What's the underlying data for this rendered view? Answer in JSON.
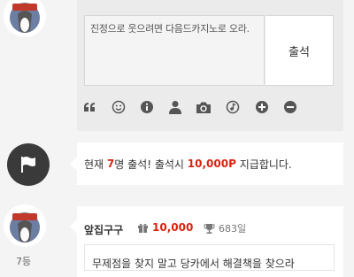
{
  "compose": {
    "text": "진정으로 웃으려면 다음드카지노로 오라.",
    "submit_label": "출석",
    "tools": [
      "quote-icon",
      "emoji-icon",
      "info-icon",
      "user-icon",
      "camera-icon",
      "music-icon",
      "plus-icon",
      "minus-icon"
    ]
  },
  "notice": {
    "prefix": "현재",
    "count": "7",
    "middle": "명 출석! 출석시",
    "points": "10,000P",
    "suffix": "지급합니다."
  },
  "entry": {
    "nickname": "앞집구구",
    "points": "10,000",
    "days": "683일",
    "rank": "7등",
    "body": "무제점을 찾지 말고 당카에서 해결책을 찾으라"
  },
  "colors": {
    "accent": "#d9230f",
    "flag_bg": "#3a3a3a"
  }
}
